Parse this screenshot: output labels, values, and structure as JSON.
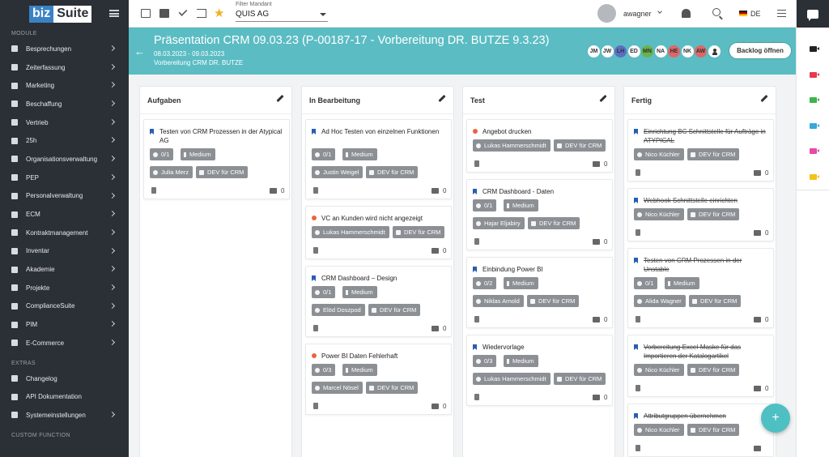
{
  "sidebar": {
    "logo_biz": "biz",
    "logo_suite": "Suite",
    "section_module": "MODULE",
    "items": [
      {
        "label": "Besprechungen"
      },
      {
        "label": "Zeiterfassung"
      },
      {
        "label": "Marketing"
      },
      {
        "label": "Beschaffung"
      },
      {
        "label": "Vertrieb"
      },
      {
        "label": "25h"
      },
      {
        "label": "Organisationsverwaltung"
      },
      {
        "label": "PEP"
      },
      {
        "label": "Personalverwaltung"
      },
      {
        "label": "ECM"
      },
      {
        "label": "Kontraktmanagement"
      },
      {
        "label": "Inventar"
      },
      {
        "label": "Akademie"
      },
      {
        "label": "Projekte"
      },
      {
        "label": "ComplianceSuite"
      },
      {
        "label": "PIM"
      },
      {
        "label": "E-Commerce"
      }
    ],
    "section_extras": "EXTRAS",
    "extras": [
      {
        "label": "Changelog"
      },
      {
        "label": "API Dokumentation"
      },
      {
        "label": "Systemeinstellungen"
      }
    ],
    "section_custom": "CUSTOM FUNCTION"
  },
  "topbar": {
    "filter_label": "Filter Mandant",
    "filter_value": "QUIS AG",
    "user_name": "awagner",
    "language": "DE"
  },
  "header": {
    "title": "Präsentation CRM 09.03.23 (P-00187-17 - Vorbereitung DR. BUTZE 9.3.23)",
    "dates": "08.03.2023 - 09.03.2023",
    "subtitle": "Vorbereitung CRM DR. BUTZE",
    "members": [
      {
        "initials": "JM",
        "color": "#ffffff"
      },
      {
        "initials": "JW",
        "color": "#ffffff"
      },
      {
        "initials": "LH",
        "color": "#5b6ec2"
      },
      {
        "initials": "ED",
        "color": "#ffffff"
      },
      {
        "initials": "MN",
        "color": "#69b34c"
      },
      {
        "initials": "NA",
        "color": "#ffffff"
      },
      {
        "initials": "HE",
        "color": "#e06666"
      },
      {
        "initials": "NK",
        "color": "#ffffff"
      },
      {
        "initials": "AW",
        "color": "#e06666"
      }
    ],
    "backlog_button": "Backlog öffnen"
  },
  "columns": [
    {
      "title": "Aufgaben",
      "cards": [
        {
          "title": "Testen von CRM Prozessen in der Atypical AG",
          "type": "story",
          "done": false,
          "progress": "0/1",
          "priority": "Medium",
          "assignee": "Julia Merz",
          "label": "DEV für CRM",
          "comments": "0"
        }
      ]
    },
    {
      "title": "In Bearbeitung",
      "cards": [
        {
          "title": "Ad Hoc Testen von einzelnen Funktionen",
          "type": "story",
          "done": false,
          "progress": "0/1",
          "priority": "Medium",
          "assignee": "Justin Weigel",
          "label": "DEV für CRM",
          "comments": "0"
        },
        {
          "title": "VC an Kunden wird nicht angezeigt",
          "type": "bug",
          "done": false,
          "progress": "",
          "priority": "",
          "assignee": "Lukas Hammerschmidt",
          "label": "DEV für CRM",
          "comments": "0"
        },
        {
          "title": "CRM Dashboard – Design",
          "type": "story",
          "done": false,
          "progress": "0/1",
          "priority": "Medium",
          "assignee": "Elöd Doszpod",
          "label": "DEV für CRM",
          "comments": "0"
        },
        {
          "title": "Power BI Daten Fehlerhaft",
          "type": "bug",
          "done": false,
          "progress": "0/3",
          "priority": "Medium",
          "assignee": "Marcel Nösel",
          "label": "DEV für CRM",
          "comments": "0"
        }
      ]
    },
    {
      "title": "Test",
      "cards": [
        {
          "title": "Angebot drucken",
          "type": "bug",
          "done": false,
          "progress": "",
          "priority": "",
          "assignee": "Lukas Hammerschmidt",
          "label": "DEV für CRM",
          "comments": "0"
        },
        {
          "title": "CRM Dashboard - Daten",
          "type": "story",
          "done": false,
          "progress": "0/1",
          "priority": "Medium",
          "assignee": "Hajar Eljabiry",
          "label": "DEV für CRM",
          "comments": "0"
        },
        {
          "title": "Einbindung Power BI",
          "type": "story",
          "done": false,
          "progress": "0/2",
          "priority": "Medium",
          "assignee": "Niklas Arnold",
          "label": "DEV für CRM",
          "comments": "0"
        },
        {
          "title": "Wiedervorlage",
          "type": "story",
          "done": false,
          "progress": "0/3",
          "priority": "Medium",
          "assignee": "Lukas Hammerschmidt",
          "label": "DEV für CRM",
          "comments": "0"
        }
      ]
    },
    {
      "title": "Fertig",
      "cards": [
        {
          "title": "Einrichtung BC Schnittstelle für Aufträge in ATYPICAL",
          "type": "story",
          "done": true,
          "progress": "",
          "priority": "",
          "assignee": "Nico Küchler",
          "label": "DEV für CRM",
          "comments": "0"
        },
        {
          "title": "Webhook Schnittstelle einrichten",
          "type": "story",
          "done": true,
          "progress": "",
          "priority": "",
          "assignee": "Nico Küchler",
          "label": "DEV für CRM",
          "comments": "0"
        },
        {
          "title": "Testen von CRM Prozessen in der Unstable",
          "type": "story",
          "done": true,
          "progress": "0/1",
          "priority": "Medium",
          "assignee": "Alida Wagner",
          "label": "DEV für CRM",
          "comments": "0"
        },
        {
          "title": "Vorbereitung Excel-Maske für das Importieren der Katalogartikel",
          "type": "story",
          "done": true,
          "progress": "",
          "priority": "",
          "assignee": "Nico Küchler",
          "label": "DEV für CRM",
          "comments": "0"
        },
        {
          "title": "Attributgruppen übernehmen",
          "type": "story",
          "done": true,
          "progress": "",
          "priority": "",
          "assignee": "Nico Küchler",
          "label": "DEV für CRM",
          "comments": ""
        }
      ]
    }
  ],
  "fab_symbol": "+",
  "rail_icon_colors": [
    "#222222",
    "#e53950",
    "#3bb54a",
    "#3aa7d9",
    "#e64aa8",
    "#f3c21a"
  ]
}
